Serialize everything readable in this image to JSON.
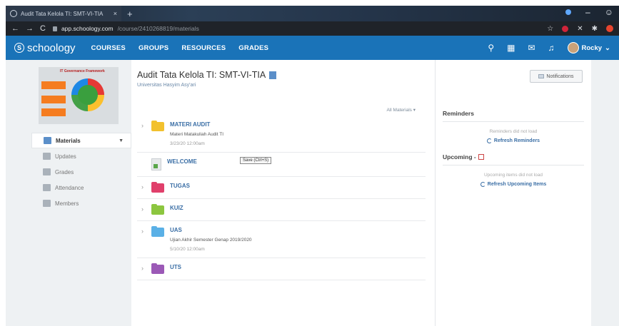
{
  "browser": {
    "tab_title": "Audit Tata Kelola TI: SMT-VI-TIA",
    "tab_close": "×",
    "new_tab": "+",
    "url_host": "app.schoology.com",
    "url_path": "/course/2410268819/materials",
    "nav_back": "←",
    "nav_forward": "→",
    "nav_reload": "C",
    "star": "☆",
    "win_min": "–"
  },
  "header": {
    "logo": "schoology",
    "menu": [
      "COURSES",
      "GROUPS",
      "RESOURCES",
      "GRADES"
    ],
    "user_name": "Rocky"
  },
  "course": {
    "image_title": "IT Governance Framework",
    "title": "Audit Tata Kelola TI: SMT-VI-TIA",
    "school": "Universitas Hasyim Asy'ari",
    "notifications_button": "Notifications"
  },
  "left_nav": {
    "items": [
      {
        "label": "Materials",
        "icon": "materials-icon"
      },
      {
        "label": "Updates",
        "icon": "updates-icon"
      },
      {
        "label": "Grades",
        "icon": "grades-icon"
      },
      {
        "label": "Attendance",
        "icon": "attendance-icon"
      },
      {
        "label": "Members",
        "icon": "members-icon"
      }
    ]
  },
  "materials": {
    "filter": "All Materials ▾",
    "tooltip": "Save (Ctrl+S)",
    "rows": [
      {
        "name": "MATERI AUDIT",
        "desc": "Materi Matakuliah Audit TI",
        "date": "3/23/20 12:00am",
        "color": "#f2c12e",
        "type": "folder"
      },
      {
        "name": "WELCOME",
        "desc": "",
        "date": "",
        "color": "#5aa64a",
        "type": "page"
      },
      {
        "name": "TUGAS",
        "desc": "",
        "date": "",
        "color": "#e0406b",
        "type": "folder"
      },
      {
        "name": "KUIZ",
        "desc": "",
        "date": "",
        "color": "#8cc63f",
        "type": "folder"
      },
      {
        "name": "UAS",
        "desc": "Ujian Akhir Semester Genap 2019/2020",
        "date": "5/10/20 12:00am",
        "color": "#5ab0e6",
        "type": "folder"
      },
      {
        "name": "UTS",
        "desc": "",
        "date": "",
        "color": "#9b59b6",
        "type": "folder"
      }
    ]
  },
  "sidebar": {
    "reminders_title": "Reminders",
    "reminders_empty": "Reminders did not load",
    "refresh_reminders": "Refresh Reminders",
    "upcoming_title": "Upcoming -",
    "upcoming_empty": "Upcoming items did not load",
    "refresh_upcoming": "Refresh Upcoming Items"
  }
}
